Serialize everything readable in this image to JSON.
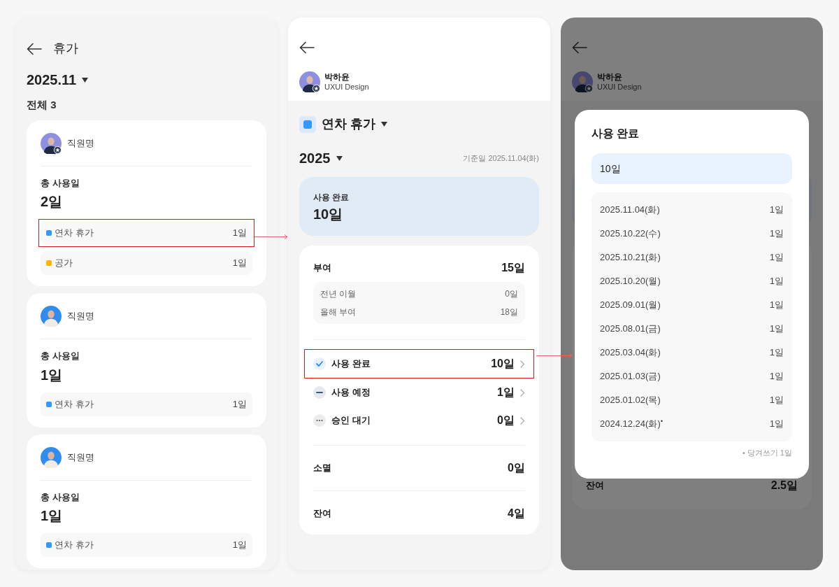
{
  "screens": [
    {
      "kind": "list",
      "title": "휴가",
      "month": "2025.11",
      "total": "전체 3",
      "employees": [
        {
          "name": "직원명",
          "avatar": {
            "kind": "violet",
            "badge": true
          },
          "total_label": "총 사용일",
          "total_value": "2일",
          "types": [
            {
              "label": "연차 휴가",
              "value": "1일",
              "color": "#3399ff",
              "highlighted": true
            },
            {
              "label": "공가",
              "value": "1일",
              "color": "#ffb300",
              "highlighted": false
            }
          ]
        },
        {
          "name": "직원명",
          "avatar": {
            "kind": "blue",
            "badge": false
          },
          "total_label": "총 사용일",
          "total_value": "1일",
          "types": [
            {
              "label": "연차 휴가",
              "value": "1일",
              "color": "#3399ff",
              "highlighted": false
            }
          ]
        },
        {
          "name": "직원명",
          "avatar": {
            "kind": "blue",
            "badge": false
          },
          "total_label": "총 사용일",
          "total_value": "1일",
          "types": [
            {
              "label": "연차 휴가",
              "value": "1일",
              "color": "#3399ff",
              "highlighted": false
            }
          ]
        }
      ]
    },
    {
      "kind": "detail",
      "profile": {
        "name": "박하윤",
        "team": "UXUI Design",
        "avatar": {
          "kind": "violet",
          "badge": true
        }
      },
      "leave_type": {
        "label": "연차 휴가",
        "color": "#3399ff"
      },
      "year": "2025",
      "as_of": "기준일 2025.11.04(화)",
      "summary": {
        "label": "사용 완료",
        "value": "10일"
      },
      "granted": {
        "label": "부여",
        "value": "15일",
        "breakdown": [
          {
            "label": "전년 이월",
            "value": "0일"
          },
          {
            "label": "올해 부여",
            "value": "18일"
          }
        ]
      },
      "statuses": [
        {
          "kind": "done",
          "label": "사용 완료",
          "value": "10일",
          "highlighted": true
        },
        {
          "kind": "planned",
          "label": "사용 예정",
          "value": "1일",
          "highlighted": false
        },
        {
          "kind": "pending",
          "label": "승인 대기",
          "value": "0일",
          "highlighted": false
        }
      ],
      "expired": {
        "label": "소멸",
        "value": "0일"
      },
      "remaining": {
        "label": "잔여",
        "value": "4일"
      }
    },
    {
      "kind": "modal",
      "profile": {
        "name": "박하윤",
        "team": "UXUI Design",
        "avatar": {
          "kind": "violet",
          "badge": true
        }
      },
      "remaining": {
        "label": "잔여",
        "value": "2.5일"
      },
      "dialog": {
        "title": "사용 완료",
        "total": "10일",
        "entries": [
          {
            "date": "2025.11.04(화)",
            "value": "1일"
          },
          {
            "date": "2025.10.22(수)",
            "value": "1일"
          },
          {
            "date": "2025.10.21(화)",
            "value": "1일"
          },
          {
            "date": "2025.10.20(월)",
            "value": "1일"
          },
          {
            "date": "2025.09.01(월)",
            "value": "1일"
          },
          {
            "date": "2025.08.01(금)",
            "value": "1일"
          },
          {
            "date": "2025.03.04(화)",
            "value": "1일"
          },
          {
            "date": "2025.01.03(금)",
            "value": "1일"
          },
          {
            "date": "2025.01.02(목)",
            "value": "1일"
          },
          {
            "date": "2024.12.24(화)$^{•}$",
            "value": "1일"
          }
        ],
        "footnote": "• 당겨쓰기 1일"
      }
    }
  ]
}
